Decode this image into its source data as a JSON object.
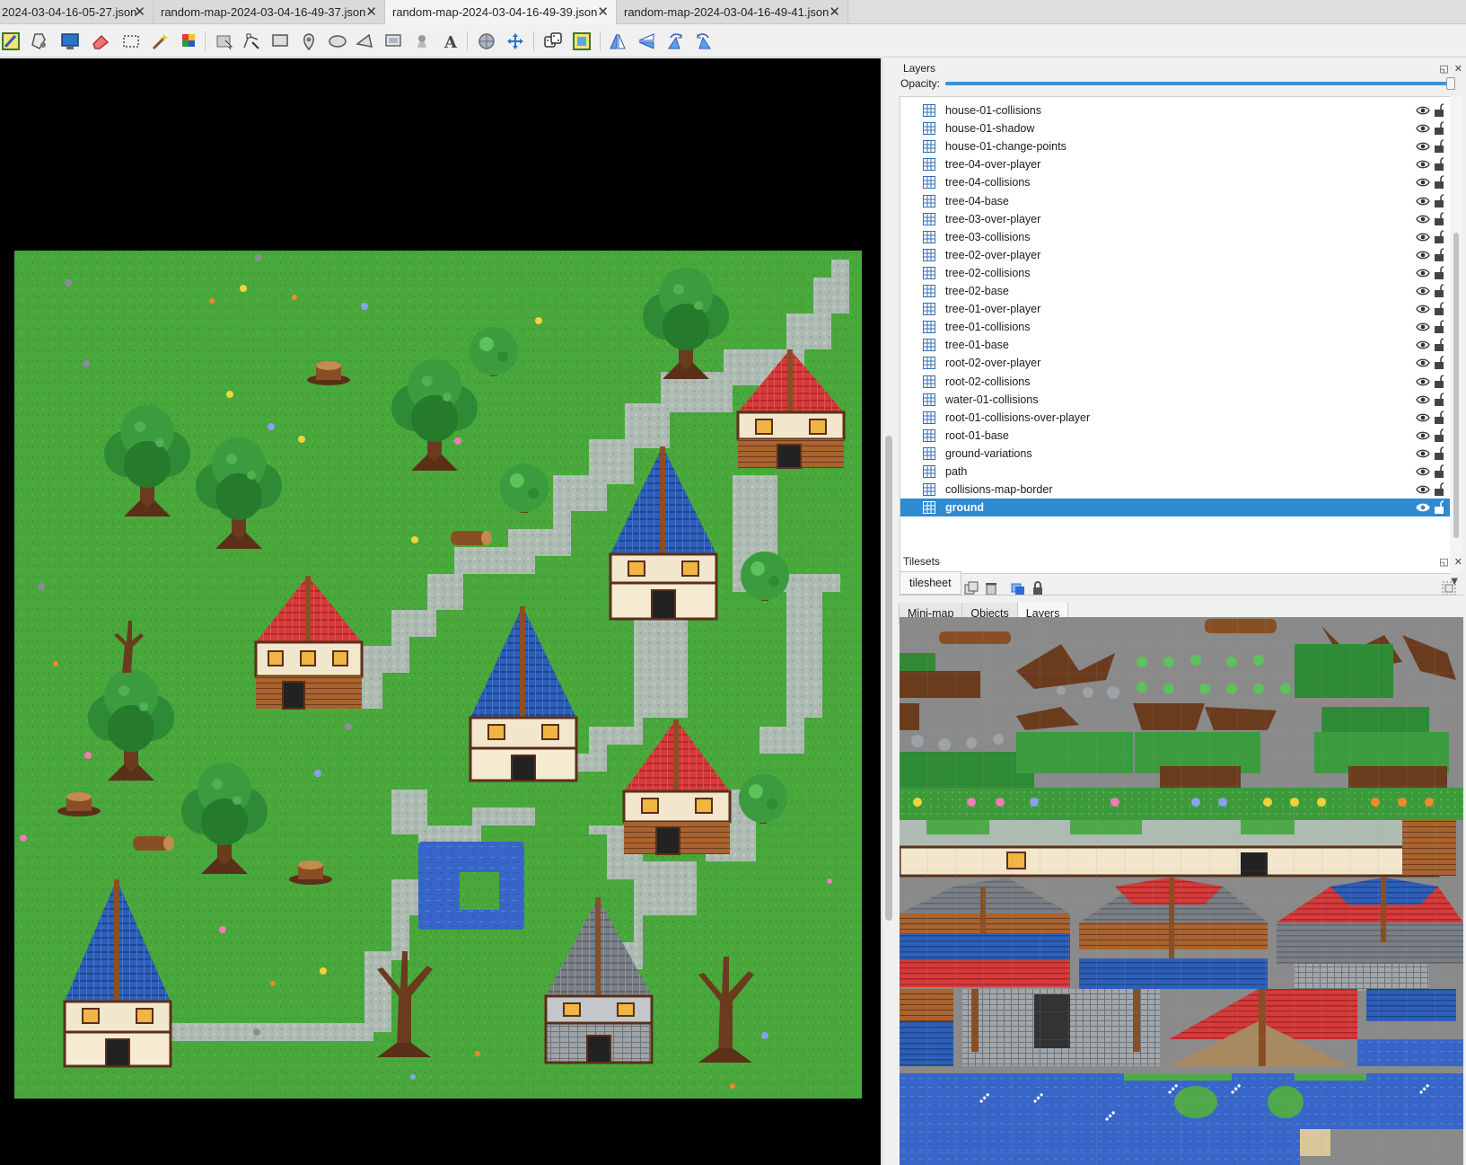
{
  "tabs": [
    {
      "label": "2024-03-04-16-05-27.json",
      "close": "✕",
      "active": false
    },
    {
      "label": "random-map-2024-03-04-16-49-37.json",
      "close": "✕",
      "active": false
    },
    {
      "label": "random-map-2024-03-04-16-49-39.json",
      "close": "✕",
      "active": true
    },
    {
      "label": "random-map-2024-03-04-16-49-41.json",
      "close": "✕",
      "active": false
    }
  ],
  "toolbar": {
    "tools": [
      "new-map-icon",
      "stamp-brush-icon",
      "terrain-brush-icon",
      "eraser-icon",
      "rectangle-select-icon",
      "magic-wand-icon",
      "bucket-fill-icon",
      "select-objects-icon",
      "edit-polygons-icon",
      "insert-rectangle-icon",
      "insert-point-icon",
      "insert-ellipse-icon",
      "insert-polygon-icon",
      "insert-tile-icon",
      "insert-template-icon",
      "insert-text-icon",
      "world-tool-icon",
      "move-icon",
      "random-mode-icon",
      "wang-fill-icon",
      "flip-horizontal-icon",
      "flip-vertical-icon",
      "rotate-left-icon",
      "rotate-right-icon"
    ]
  },
  "layers_panel": {
    "title": "Layers",
    "opacity_label": "Opacity:",
    "opacity_value": 1.0,
    "selected_layer": "ground",
    "layers": [
      "house-01-collisions",
      "house-01-shadow",
      "house-01-change-points",
      "tree-04-over-player",
      "tree-04-collisions",
      "tree-04-base",
      "tree-03-over-player",
      "tree-03-collisions",
      "tree-02-over-player",
      "tree-02-collisions",
      "tree-02-base",
      "tree-01-over-player",
      "tree-01-collisions",
      "tree-01-base",
      "root-02-over-player",
      "root-02-collisions",
      "water-01-collisions",
      "root-01-collisions-over-player",
      "root-01-base",
      "ground-variations",
      "path",
      "collisions-map-border",
      "ground"
    ]
  },
  "dock_tabs": [
    "Mini-map",
    "Objects",
    "Layers"
  ],
  "active_dock_tab": "Layers",
  "tilesets_panel": {
    "title": "Tilesets",
    "tab": "tilesheet"
  },
  "colors": {
    "selection": "#2f8ad0",
    "grass": "#48a83c",
    "path": "#aebbb3",
    "roof_red": "#d63a3a",
    "roof_blue": "#2d5fb8",
    "roof_gray": "#7a7f86",
    "water": "#3766c8",
    "foliage": "#2f8a35",
    "trunk": "#6b3b1e"
  }
}
